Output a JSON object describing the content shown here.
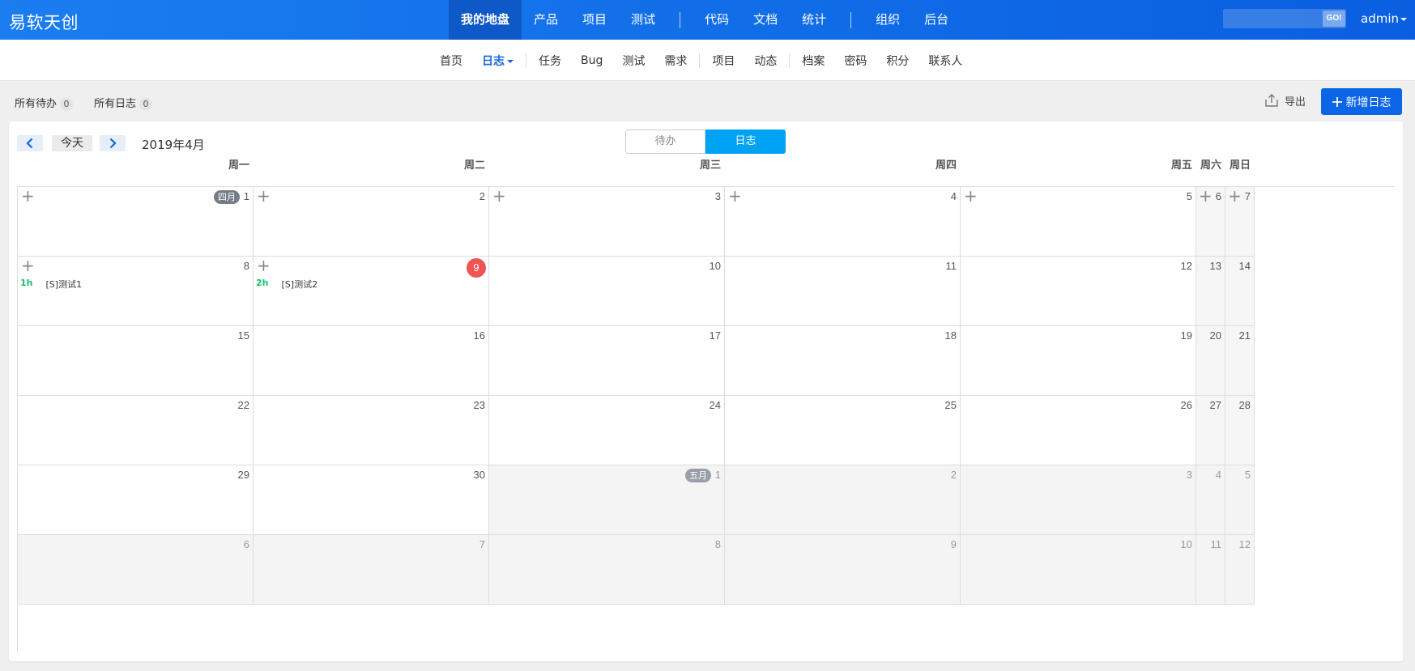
{
  "header": {
    "brand": "易软天创",
    "nav": [
      {
        "label": "我的地盘",
        "active": true
      },
      {
        "label": "产品"
      },
      {
        "label": "项目"
      },
      {
        "label": "测试"
      },
      {
        "sep": true
      },
      {
        "label": "代码"
      },
      {
        "label": "文档"
      },
      {
        "label": "统计"
      },
      {
        "sep": true
      },
      {
        "label": "组织"
      },
      {
        "label": "后台"
      }
    ],
    "search_go": "GO!",
    "search_value": "",
    "user": "admin"
  },
  "subnav": {
    "items": [
      {
        "label": "首页"
      },
      {
        "label": "日志",
        "active": true,
        "dropdown": true
      },
      {
        "sep": true
      },
      {
        "label": "任务"
      },
      {
        "label": "Bug"
      },
      {
        "label": "测试"
      },
      {
        "label": "需求"
      },
      {
        "sep": true
      },
      {
        "label": "项目"
      },
      {
        "label": "动态"
      },
      {
        "sep": true
      },
      {
        "label": "档案"
      },
      {
        "label": "密码"
      },
      {
        "label": "积分"
      },
      {
        "label": "联系人"
      }
    ]
  },
  "toolbar": {
    "all_todo_label": "所有待办",
    "all_todo_count": "0",
    "all_log_label": "所有日志",
    "all_log_count": "0",
    "export_label": "导出",
    "add_label": "新增日志"
  },
  "calendar": {
    "today_label": "今天",
    "month_title": "2019年4月",
    "view_todo": "待办",
    "view_log": "日志",
    "weekdays": [
      "周一",
      "周二",
      "周三",
      "周四",
      "周五",
      "周六",
      "周日"
    ],
    "weeks": [
      [
        {
          "d": "1",
          "badge": "四月",
          "plus": true
        },
        {
          "d": "2",
          "plus": true
        },
        {
          "d": "3",
          "plus": true
        },
        {
          "d": "4",
          "plus": true
        },
        {
          "d": "5",
          "plus": true
        },
        {
          "d": "6",
          "plus": true
        },
        {
          "d": "7",
          "plus": true
        }
      ],
      [
        {
          "d": "8",
          "plus": true,
          "event": {
            "hours": "1h",
            "name": "[S]测试1"
          }
        },
        {
          "d": "9",
          "plus": true,
          "today": true,
          "event": {
            "hours": "2h",
            "name": "[S]测试2"
          }
        },
        {
          "d": "10"
        },
        {
          "d": "11"
        },
        {
          "d": "12"
        },
        {
          "d": "13"
        },
        {
          "d": "14"
        }
      ],
      [
        {
          "d": "15"
        },
        {
          "d": "16"
        },
        {
          "d": "17"
        },
        {
          "d": "18"
        },
        {
          "d": "19"
        },
        {
          "d": "20"
        },
        {
          "d": "21"
        }
      ],
      [
        {
          "d": "22"
        },
        {
          "d": "23"
        },
        {
          "d": "24"
        },
        {
          "d": "25"
        },
        {
          "d": "26"
        },
        {
          "d": "27"
        },
        {
          "d": "28"
        }
      ],
      [
        {
          "d": "29"
        },
        {
          "d": "30"
        },
        {
          "d": "1",
          "other": true,
          "badge": "五月"
        },
        {
          "d": "2",
          "other": true
        },
        {
          "d": "3",
          "other": true
        },
        {
          "d": "4",
          "other": true
        },
        {
          "d": "5",
          "other": true
        }
      ],
      [
        {
          "d": "6",
          "other": true
        },
        {
          "d": "7",
          "other": true
        },
        {
          "d": "8",
          "other": true
        },
        {
          "d": "9",
          "other": true
        },
        {
          "d": "10",
          "other": true
        },
        {
          "d": "11",
          "other": true
        },
        {
          "d": "12",
          "other": true
        }
      ]
    ]
  }
}
